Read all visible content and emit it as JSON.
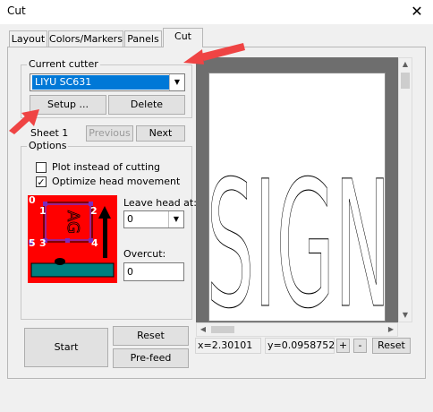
{
  "window": {
    "title": "Cut",
    "close_glyph": "✕"
  },
  "tabs": [
    {
      "label": "Layout"
    },
    {
      "label": "Colors/Markers"
    },
    {
      "label": "Panels"
    },
    {
      "label": "Cut",
      "active": true
    }
  ],
  "cutter": {
    "group_label": "Current cutter",
    "selected": "LIYU SC631",
    "setup_label": "Setup ...",
    "delete_label": "Delete"
  },
  "sheet": {
    "label": "Sheet 1",
    "previous_label": "Previous",
    "next_label": "Next"
  },
  "options": {
    "group_label": "Options",
    "plot_instead_label": "Plot instead of cutting",
    "plot_instead_checked": false,
    "optimize_label": "Optimize head movement",
    "optimize_checked": true,
    "checkmark": "✓",
    "leave_head_label": "Leave head at:",
    "leave_head_value": "0",
    "overcut_label": "Overcut:",
    "overcut_value": "0",
    "head_positions": [
      "0",
      "1",
      "2",
      "3",
      "4",
      "5"
    ],
    "diagram_letters": "AG"
  },
  "actions": {
    "start_label": "Start",
    "reset_label": "Reset",
    "prefeed_label": "Pre-feed"
  },
  "preview": {
    "letters": "SIGN",
    "x_readout": "x=2.30101",
    "y_readout": "y=0.0958752",
    "zoom_in": "+",
    "zoom_out": "-",
    "reset_label": "Reset"
  },
  "colors": {
    "head_diagram_bg": "#ff0000",
    "media_bar": "#008080",
    "annotation_arrow": "#ef4444",
    "selection": "#0078d7"
  }
}
